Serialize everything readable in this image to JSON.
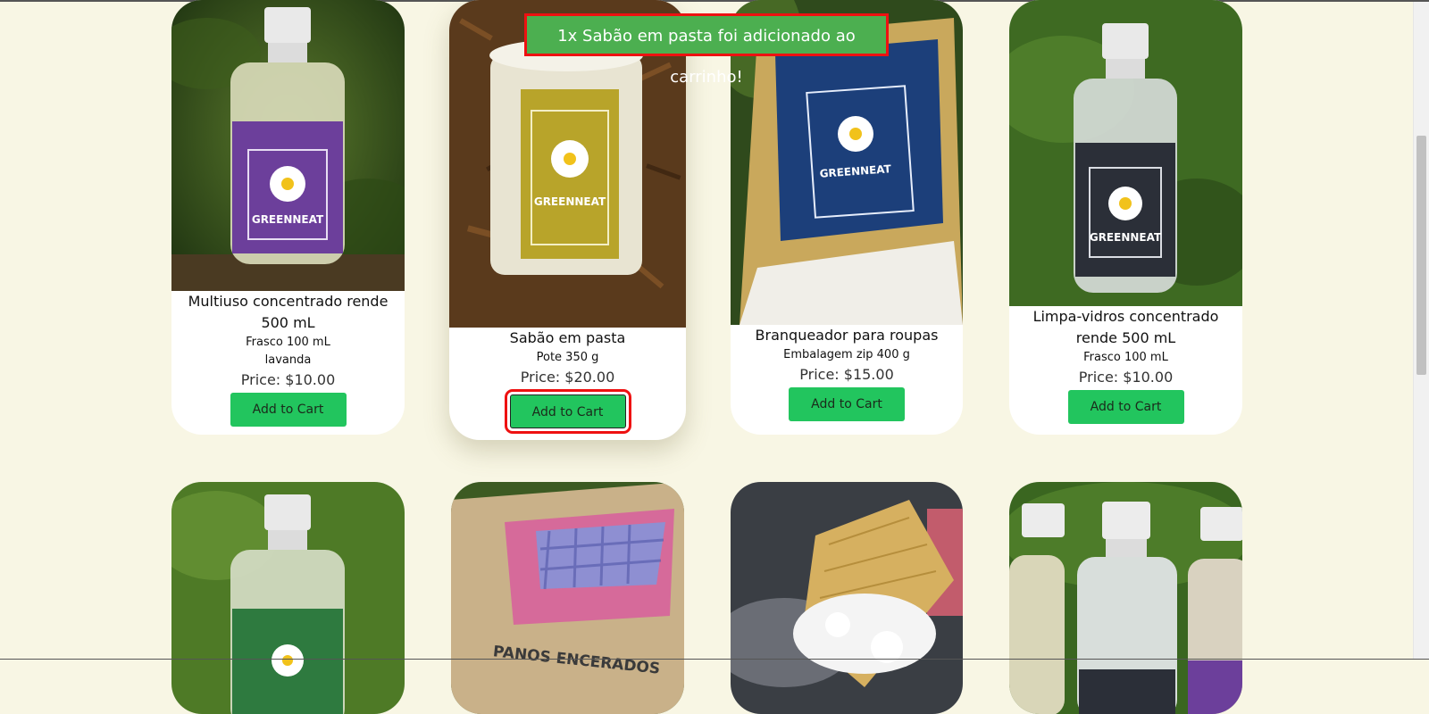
{
  "toast": {
    "message": "1x Sabão em pasta foi adicionado ao carrinho!"
  },
  "products_row1": [
    {
      "name": "Multiuso concentrado rende 500 mL",
      "detail1": "Frasco 100 mL",
      "detail2": "lavanda",
      "price": "Price: $10.00",
      "button": "Add to Cart",
      "image": "purple-bottle"
    },
    {
      "name": "Sabão em pasta",
      "detail1": "Pote 350 g",
      "price": "Price: $20.00",
      "button": "Add to Cart",
      "image": "paste-jar"
    },
    {
      "name": "Branqueador para roupas",
      "detail1": "Embalagem zip 400 g",
      "price": "Price: $15.00",
      "button": "Add to Cart",
      "image": "kraft-pouch"
    },
    {
      "name": "Limpa-vidros concentrado rende 500 mL",
      "detail1": "Frasco 100 mL",
      "price": "Price: $10.00",
      "button": "Add to Cart",
      "image": "dark-bottle"
    }
  ],
  "product_images_row2": [
    "green-bottle",
    "wax-wraps",
    "loofah-foam",
    "bottle-set"
  ],
  "label_text": {
    "brand": "GREENNEAT",
    "panos": "PANOS ENCERADOS"
  },
  "colors": {
    "background": "#f8f6e4",
    "button": "#22c55e",
    "toast": "#4caf50",
    "highlight": "#e11111"
  }
}
